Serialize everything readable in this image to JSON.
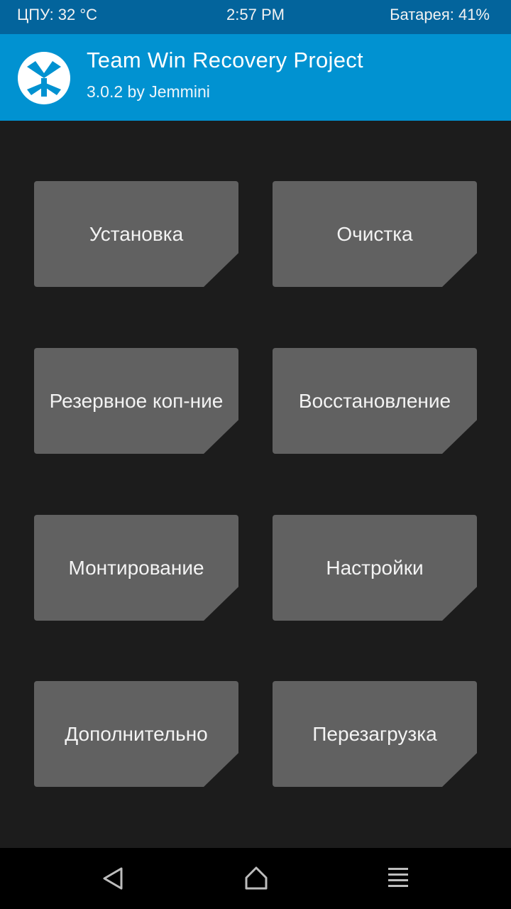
{
  "status_bar": {
    "cpu": "ЦПУ: 32 °C",
    "time": "2:57 PM",
    "battery": "Батарея: 41%"
  },
  "header": {
    "title": "Team Win Recovery Project",
    "subtitle": "3.0.2 by Jemmini",
    "logo_icon": "twrp-logo-icon"
  },
  "menu": {
    "install_label": "Установка",
    "wipe_label": "Очистка",
    "backup_label": "Резервное коп-ние",
    "restore_label": "Восстановление",
    "mount_label": "Монтирование",
    "settings_label": "Настройки",
    "advanced_label": "Дополнительно",
    "reboot_label": "Перезагрузка"
  },
  "nav_bar": {
    "back_icon": "back-triangle-icon",
    "home_icon": "home-icon",
    "menu_icon": "menu-lines-icon"
  },
  "colors": {
    "status_bar_bg": "#03649c",
    "header_bg": "#0192d1",
    "background": "#1c1c1c",
    "tile_bg": "#616161",
    "nav_bar_bg": "#000000",
    "text": "#f3f3f3"
  }
}
